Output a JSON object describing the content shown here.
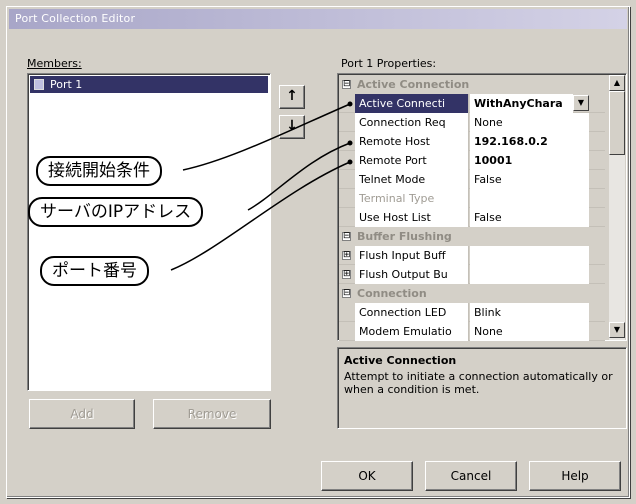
{
  "dialog": {
    "title": "Port Collection Editor"
  },
  "members": {
    "label": "Members:",
    "items": [
      {
        "label": "Port 1"
      }
    ],
    "add_label": "Add",
    "remove_label": "Remove"
  },
  "arrows": {
    "up": "↑",
    "down": "↓"
  },
  "properties": {
    "label": "Port 1 Properties:",
    "rows": [
      {
        "kind": "category",
        "expander": "⊟",
        "name": "Active Connection"
      },
      {
        "kind": "prop",
        "name": "Active Connecti",
        "value": "WithAnyChara",
        "selected": true,
        "bold": true,
        "dropdown": true
      },
      {
        "kind": "prop",
        "name": "Connection Req",
        "value": "None"
      },
      {
        "kind": "prop",
        "name": "Remote Host",
        "value": "192.168.0.2",
        "bold": true
      },
      {
        "kind": "prop",
        "name": "Remote Port",
        "value": "10001",
        "bold": true
      },
      {
        "kind": "prop",
        "name": "Telnet Mode",
        "value": "False"
      },
      {
        "kind": "prop",
        "name": "Terminal Type",
        "value": "",
        "dim": true
      },
      {
        "kind": "prop",
        "name": "Use Host List",
        "value": "False"
      },
      {
        "kind": "category",
        "expander": "⊟",
        "name": "Buffer Flushing"
      },
      {
        "kind": "prop",
        "name": "Flush Input Buff",
        "value": "",
        "expander": "⊞"
      },
      {
        "kind": "prop",
        "name": "Flush Output Bu",
        "value": "",
        "expander": "⊞"
      },
      {
        "kind": "category",
        "expander": "⊟",
        "name": "Connection"
      },
      {
        "kind": "prop",
        "name": "Connection LED",
        "value": "Blink"
      },
      {
        "kind": "prop",
        "name": "Modem Emulatio",
        "value": "None"
      }
    ],
    "description_title": "Active Connection",
    "description_text": "Attempt to initiate a connection automatically or when a condition is met."
  },
  "callouts": [
    {
      "text": "接続開始条件"
    },
    {
      "text": "サーバのIPアドレス"
    },
    {
      "text": "ポート番号"
    }
  ],
  "buttons": {
    "ok": "OK",
    "cancel": "Cancel",
    "help": "Help"
  },
  "colors": {
    "selection": "#333366",
    "face": "#d4d0c8"
  }
}
